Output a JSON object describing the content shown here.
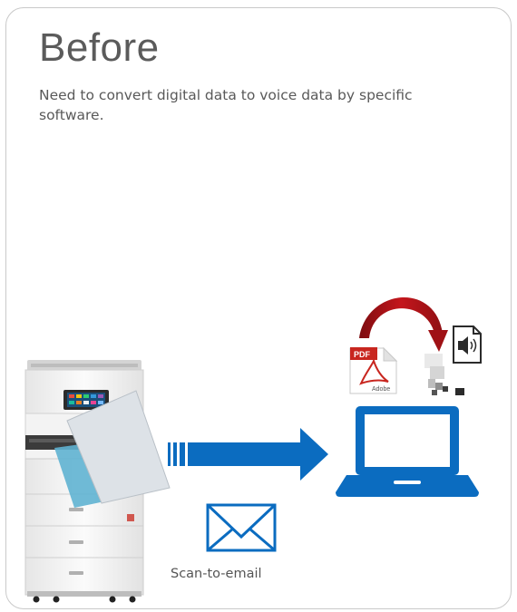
{
  "panel": {
    "title": "Before",
    "description": "Need to convert digital data to voice data by specific software."
  },
  "diagram": {
    "pdf_icon": {
      "badge": "PDF",
      "brand": "Adobe"
    },
    "email_label": "Scan-to-email",
    "colors": {
      "blue": "#0b6cc0",
      "red_arrow": "#b5161b",
      "pdf_red": "#c8261f",
      "paper_blue": "#5fb3d2"
    }
  }
}
